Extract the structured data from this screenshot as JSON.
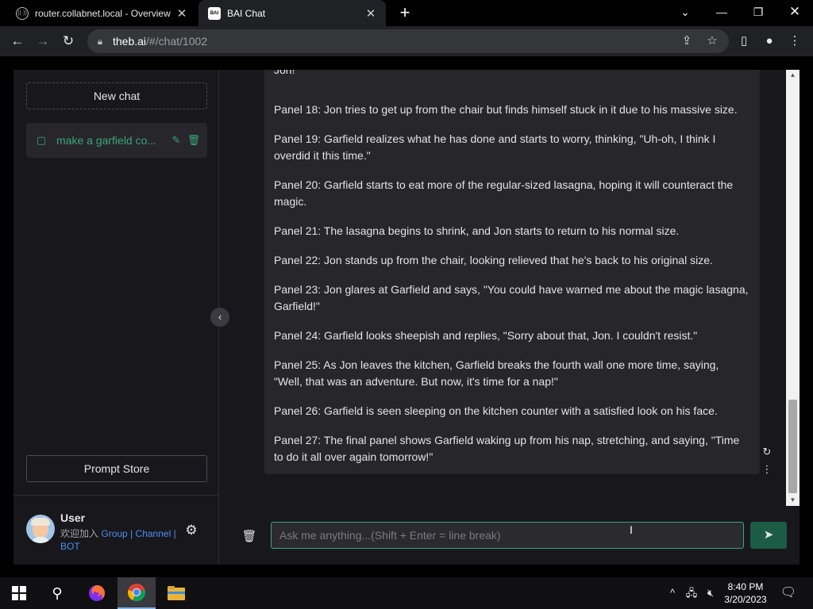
{
  "browser": {
    "tabs": [
      {
        "title": "router.collabnet.local - Overview",
        "favicon_icon": "router-icon"
      },
      {
        "title": "BAI Chat",
        "favicon_icon": "bai-logo-icon",
        "favicon_text": "BAI"
      }
    ],
    "url_host": "theb.ai",
    "url_path": "/#/chat/1002"
  },
  "sidebar": {
    "new_chat_label": "New chat",
    "chats": [
      {
        "title": "make a garfield co..."
      }
    ],
    "prompt_store_label": "Prompt Store",
    "user": {
      "name": "User",
      "desc_prefix": "欢迎加入",
      "links": [
        "Group",
        "Channel",
        "BOT"
      ],
      "separator": "|"
    }
  },
  "conversation": {
    "top_partial": "Jon!\"",
    "panels": [
      "Panel 18: Jon tries to get up from the chair but finds himself stuck in it due to his massive size.",
      "Panel 19: Garfield realizes what he has done and starts to worry, thinking, \"Uh-oh, I think I overdid it this time.\"",
      "Panel 20: Garfield starts to eat more of the regular-sized lasagna, hoping it will counteract the magic.",
      "Panel 21: The lasagna begins to shrink, and Jon starts to return to his normal size.",
      "Panel 22: Jon stands up from the chair, looking relieved that he's back to his original size.",
      "Panel 23: Jon glares at Garfield and says, \"You could have warned me about the magic lasagna, Garfield!\"",
      "Panel 24: Garfield looks sheepish and replies, \"Sorry about that, Jon. I couldn't resist.\"",
      "Panel 25: As Jon leaves the kitchen, Garfield breaks the fourth wall one more time, saying, \"Well, that was an adventure. But now, it's time for a nap!\"",
      "Panel 26: Garfield is seen sleeping on the kitchen counter with a satisfied look on his face.",
      "Panel 27: The final panel shows Garfield waking up from his nap, stretching, and saying, \"Time to do it all over again tomorrow!\""
    ]
  },
  "input": {
    "placeholder": "Ask me anything...(Shift + Enter = line break)",
    "value": ""
  },
  "taskbar": {
    "time": "8:40 PM",
    "date": "3/20/2023"
  },
  "colors": {
    "accent": "#3ba57a",
    "link": "#4b8ef0",
    "background": "#18181c",
    "message_bg": "#26262b"
  }
}
